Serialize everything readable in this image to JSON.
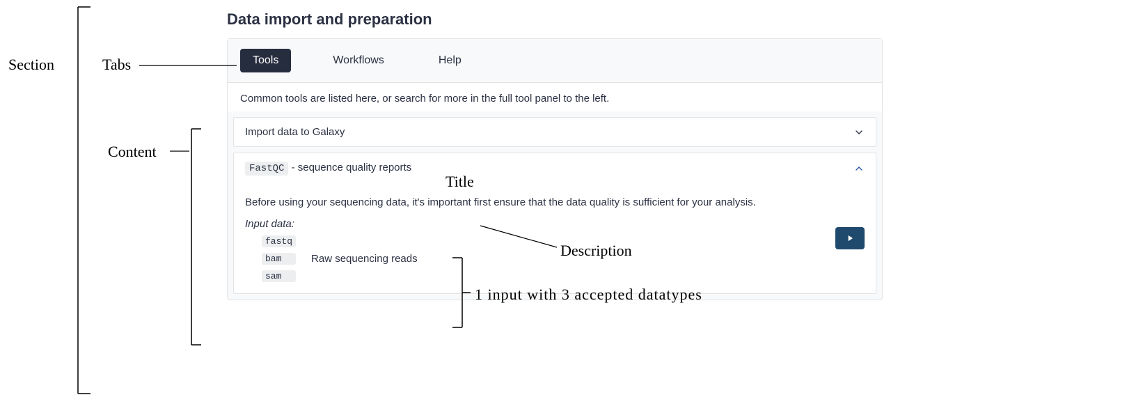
{
  "section_title": "Data import and preparation",
  "tabs": [
    {
      "label": "Tools",
      "active": true
    },
    {
      "label": "Workflows",
      "active": false
    },
    {
      "label": "Help",
      "active": false
    }
  ],
  "note": "Common tools are listed here, or search for more in the full tool panel to the left.",
  "items": [
    {
      "title_plain": "Import data to Galaxy",
      "expanded": false
    },
    {
      "tool_code": "FastQC",
      "title_suffix": " - sequence quality reports",
      "expanded": true,
      "description": "Before using your sequencing data, it's important first ensure that the data quality is sufficient for your analysis.",
      "input_heading": "Input data:",
      "input_datatypes": [
        "fastq",
        "bam",
        "sam"
      ],
      "input_label": "Raw sequencing reads"
    }
  ],
  "annotations": {
    "section": "Section",
    "tabs": "Tabs",
    "content": "Content",
    "title": "Title",
    "description": "Description",
    "input_note": "1 input with 3 accepted datatypes"
  }
}
